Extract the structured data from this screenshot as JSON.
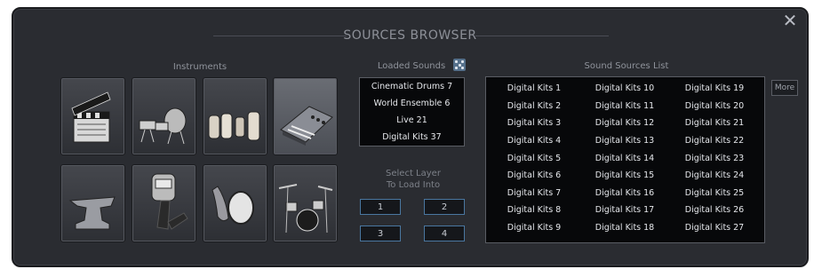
{
  "window": {
    "title": "SOURCES BROWSER",
    "close_glyph": "✕"
  },
  "instruments": {
    "label": "Instruments",
    "icons": [
      {
        "name": "clapperboard-icon",
        "selected": false
      },
      {
        "name": "marching-percussion-icon",
        "selected": false
      },
      {
        "name": "conga-drums-icon",
        "selected": false
      },
      {
        "name": "synthesizer-icon",
        "selected": true
      },
      {
        "name": "anvil-icon",
        "selected": false
      },
      {
        "name": "stopwatch-icon",
        "selected": false
      },
      {
        "name": "frame-drum-icon",
        "selected": false
      },
      {
        "name": "drum-kit-icon",
        "selected": false
      }
    ]
  },
  "loaded_sounds": {
    "label": "Loaded Sounds",
    "random_icon": "dice-icon",
    "items": [
      "Cinematic Drums 7",
      "World Ensemble 6",
      "Live 21",
      "Digital Kits 37"
    ]
  },
  "select_layer": {
    "label_line1": "Select Layer",
    "label_line2": "To Load Into",
    "buttons": [
      "1",
      "2",
      "3",
      "4"
    ]
  },
  "sound_sources": {
    "label": "Sound Sources List",
    "more_label": "More",
    "columns": [
      [
        "Digital Kits 1",
        "Digital Kits 2",
        "Digital Kits 3",
        "Digital Kits 4",
        "Digital Kits 5",
        "Digital Kits 6",
        "Digital Kits 7",
        "Digital Kits 8",
        "Digital Kits 9"
      ],
      [
        "Digital Kits 10",
        "Digital Kits 11",
        "Digital Kits 12",
        "Digital Kits 13",
        "Digital Kits 14",
        "Digital Kits 15",
        "Digital Kits 16",
        "Digital Kits 17",
        "Digital Kits 18"
      ],
      [
        "Digital Kits 19",
        "Digital Kits 20",
        "Digital Kits 21",
        "Digital Kits 22",
        "Digital Kits 23",
        "Digital Kits 24",
        "Digital Kits 25",
        "Digital Kits 26",
        "Digital Kits 27"
      ]
    ]
  },
  "colors": {
    "panel": "#2a2c31",
    "layer_button_border": "#4a77a0",
    "list_background": "#07080a"
  }
}
